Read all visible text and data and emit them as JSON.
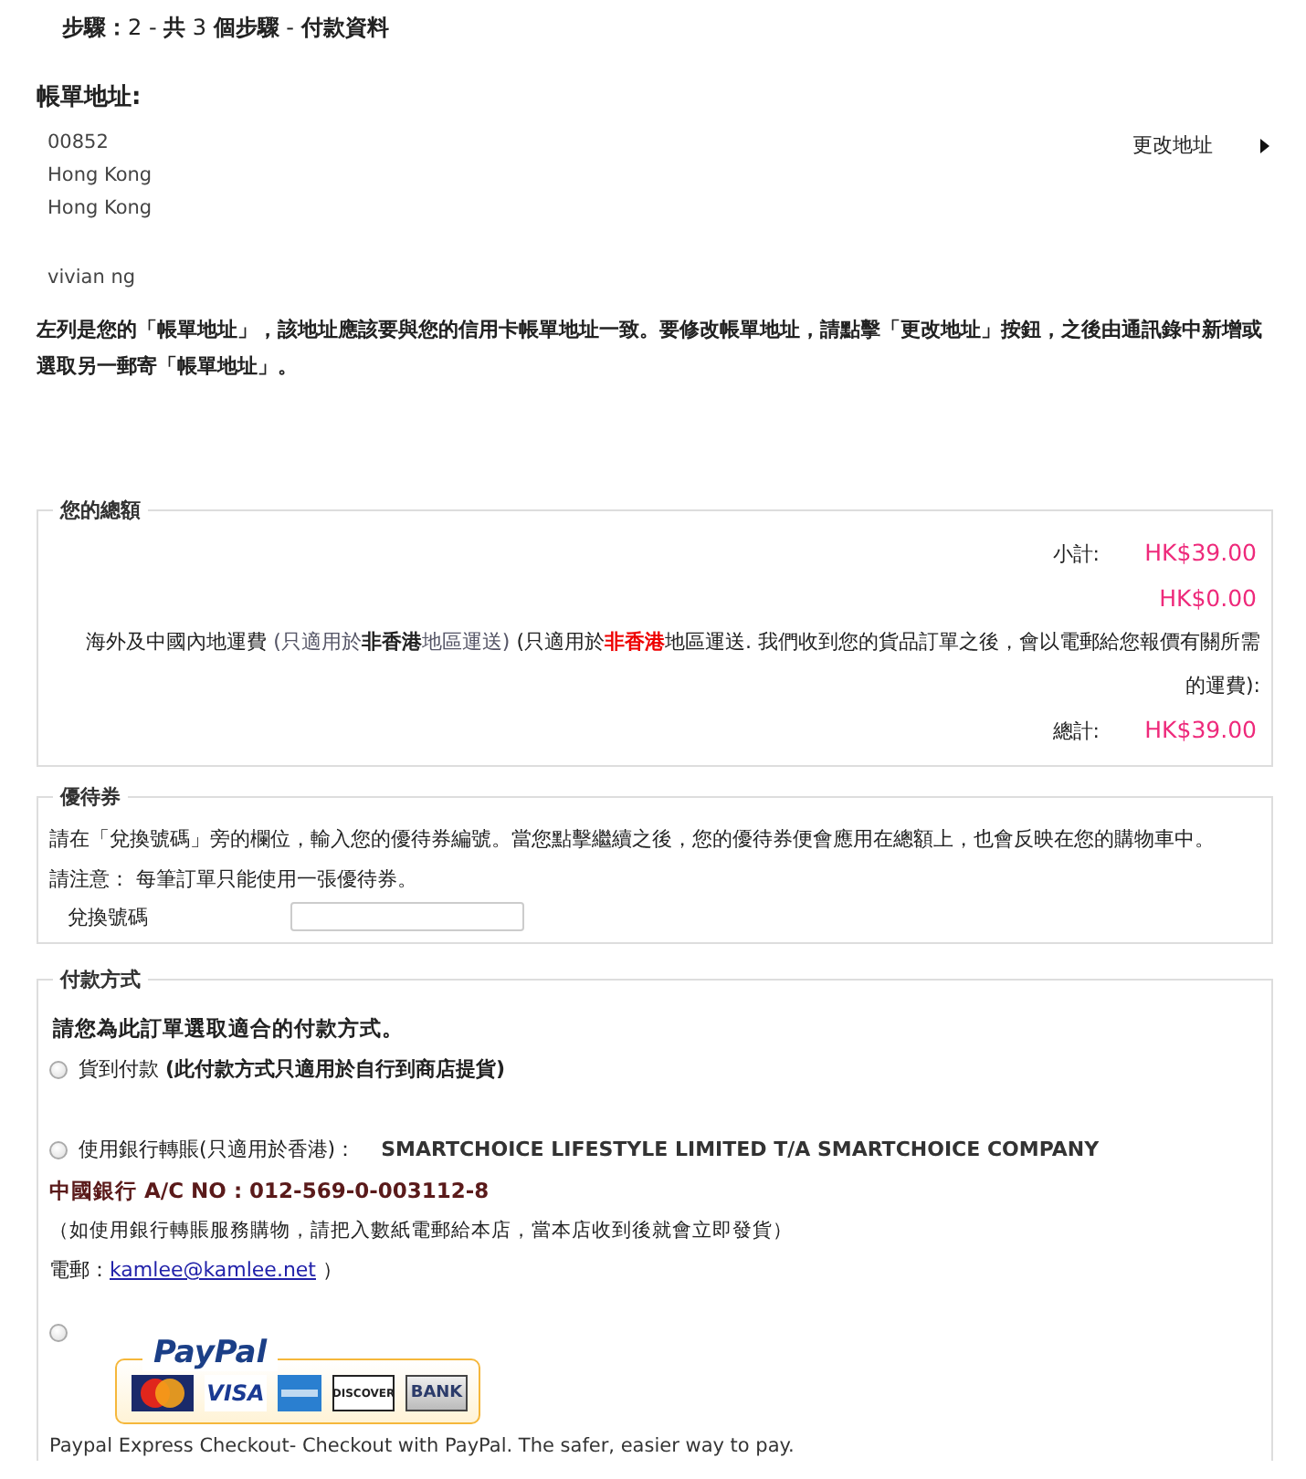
{
  "step_header": "**步驟：**2 - **共** 3 **個步驟** - **付款資料**",
  "billing": {
    "title": "帳單地址:",
    "address_lines": [
      "00852",
      "Hong Kong",
      "Hong Kong"
    ],
    "name": "vivian ng",
    "change_link": "更改地址",
    "note": "左列是您的「帳單地址」，該地址應該要與您的信用卡帳單地址一致。要修改帳單地址，請點擊「更改地址」按鈕，之後由通訊錄中新增或選取另一郵寄「帳單地址」。"
  },
  "totals": {
    "legend": "您的總額",
    "rows": [
      {
        "kind": "amount",
        "label": "小計:",
        "value": "HK$39.00"
      },
      {
        "kind": "amount",
        "value": "HK$0.00"
      },
      {
        "kind": "text",
        "segments": [
          {
            "kind": "plain",
            "text": "海外及中國內地運費 "
          },
          {
            "kind": "muted",
            "text": "(只適用於"
          },
          {
            "kind": "bold",
            "text": "非香港"
          },
          {
            "kind": "muted",
            "text": "地區運送)"
          },
          {
            "kind": "plain",
            "text": " (只適用於"
          },
          {
            "kind": "alert",
            "text": "非香港"
          },
          {
            "kind": "plain",
            "text": "地區運送. 我們收到您的貨品訂單之後，會以電郵給您報價有關所需的運費):"
          }
        ]
      },
      {
        "kind": "amount",
        "label": "總計:",
        "value": "HK$39.00"
      }
    ]
  },
  "coupon": {
    "legend": "優待券",
    "text": "請在「兌換號碼」旁的欄位，輸入您的優待券編號。當您點擊繼續之後，您的優待券便會應用在總額上，也會反映在您的購物車中。",
    "note": "請注意： 每筆訂單只能使用一張優待券。",
    "field_label": "兌換號碼"
  },
  "payment": {
    "legend": "付款方式",
    "intro": "請您為此訂單選取適合的付款方式。",
    "options": [
      {
        "kind": "cod",
        "selected": false,
        "label": "貨到付款 **(此付款方式只適用於自行到商店提貨)**"
      },
      {
        "kind": "bank",
        "selected": false,
        "label": "使用銀行轉賬(只適用於香港)：",
        "company": "SMARTCHOICE LIFESTYLE LIMITED T/A SMARTCHOICE COMPANY",
        "account": "中國銀行 A/C NO : 012-569-0-003112-8",
        "note": "（如使用銀行轉賬服務購物，請把入數紙電郵給本店，當本店收到後就會立即發貨）",
        "email_label": "電郵：",
        "email": "kamlee@kamlee.net",
        "email_suffix": "）"
      },
      {
        "kind": "paypal",
        "selected": false,
        "logo": "PayPal",
        "cards": [
          {
            "kind": "mastercard"
          },
          {
            "kind": "label",
            "text": "VISA"
          },
          {
            "kind": "amex"
          },
          {
            "kind": "discover",
            "text": "DISCOVER"
          },
          {
            "kind": "bank",
            "text": "BANK"
          }
        ],
        "description": "Paypal Express Checkout- Checkout with PayPal. The safer, easier way to pay."
      }
    ]
  }
}
